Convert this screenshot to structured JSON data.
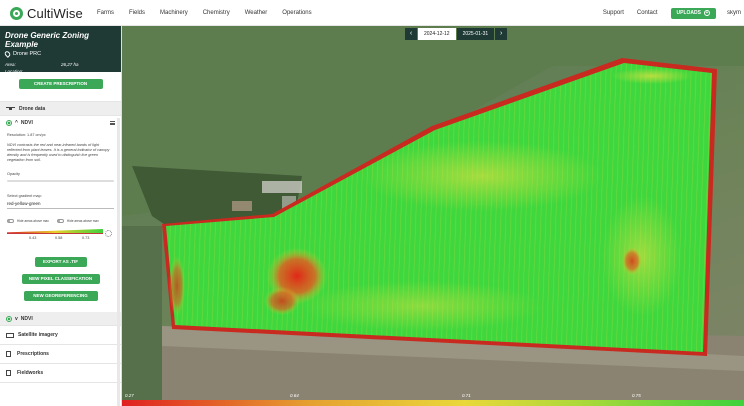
{
  "app": {
    "name": "CultiWise"
  },
  "nav": {
    "items": [
      "Farms",
      "Fields",
      "Machinery",
      "Chemistry",
      "Weather",
      "Operations"
    ],
    "support": "Support",
    "contact": "Contact",
    "uploads": "UPLOADS",
    "user": "skym"
  },
  "project": {
    "title": "Drone Generic Zoning Example",
    "subtitle": "Drone PRC",
    "area_label": "Area:",
    "area_value": "26,27 ha",
    "location_label": "Location:"
  },
  "sidebar": {
    "create_prescription": "CREATE PRESCRIPTION",
    "drone_data": "Drone data",
    "ndvi_label": "NDVI",
    "resolution": "Resolution: 1.87 cm/px",
    "description": "NDVI contrasts the red and near-infrared bands of light reflected from plant leaves. It is a general indicator of canopy density and is frequently used to distinguish live green vegetation from soil.",
    "opacity_label": "Opacity",
    "opacity_value": 0,
    "gradient_label": "Select gradient map:",
    "gradient_value": "red-yellow-green",
    "toggle1": "Hide areas above max",
    "toggle2": "Hide areas above max",
    "ramp_min": "0.43",
    "ramp_mid": "0.58",
    "ramp_max": "0.73",
    "export_btn": "EXPORT AS .TIF",
    "pixel_btn": "NEW PIXEL CLASSIFICATION",
    "geo_btn": "NEW GEOREFERENCING",
    "ndvi_label_2": "NDVI",
    "satellite": "Satellite imagery",
    "prescriptions": "Prescriptions",
    "fieldworks": "Fieldworks"
  },
  "map": {
    "date_left": "2024-12-12",
    "date_right": "2025-01-31",
    "legend": [
      "0.27",
      "0.64",
      "0.71",
      "0.75"
    ]
  },
  "colors": {
    "accent": "#3aa857",
    "header": "#1f3a35"
  }
}
